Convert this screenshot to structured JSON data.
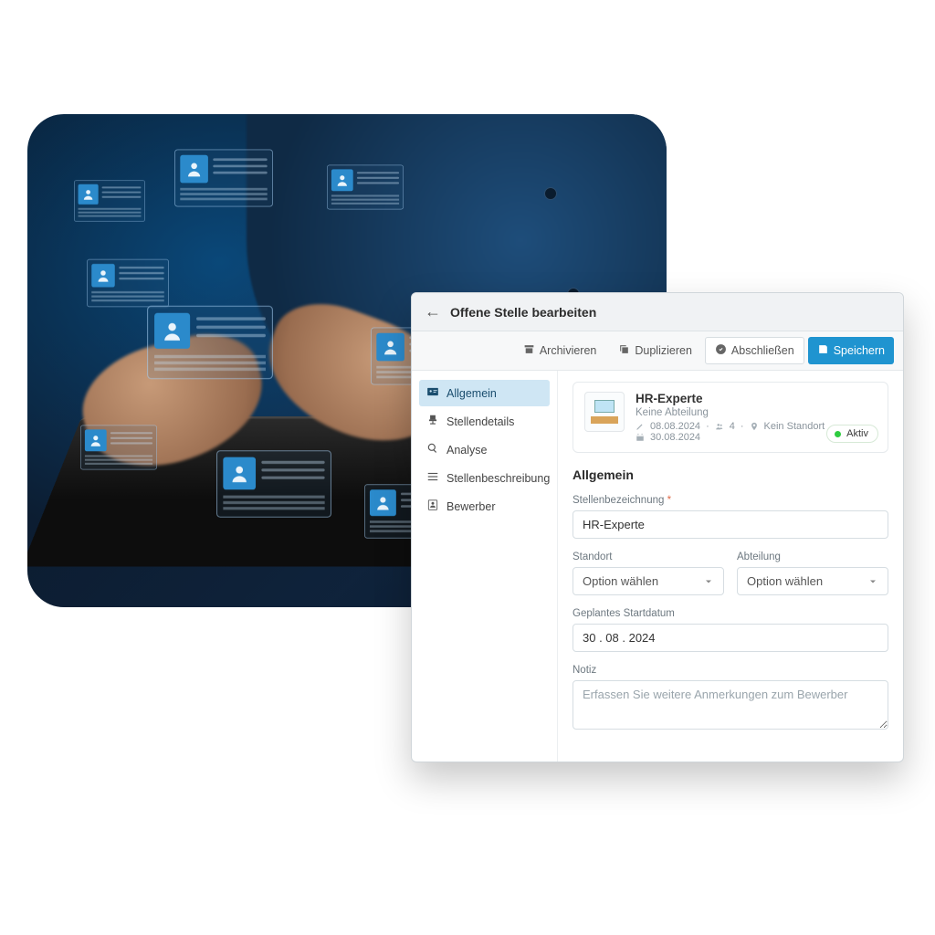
{
  "header": {
    "title": "Offene Stelle bearbeiten"
  },
  "toolbar": {
    "archive": "Archivieren",
    "duplicate": "Duplizieren",
    "close": "Abschließen",
    "save": "Speichern"
  },
  "sidebar": {
    "items": [
      {
        "label": "Allgemein"
      },
      {
        "label": "Stellendetails"
      },
      {
        "label": "Analyse"
      },
      {
        "label": "Stellenbeschreibung"
      },
      {
        "label": "Bewerber"
      }
    ]
  },
  "summary": {
    "title": "HR-Experte",
    "department": "Keine Abteilung",
    "created": "08.08.2024",
    "applicants": "4",
    "location": "Kein Standort",
    "startdate": "30.08.2024",
    "status": "Aktiv"
  },
  "form": {
    "section_title": "Allgemein",
    "job_title": {
      "label": "Stellenbezeichnung",
      "value": "HR-Experte"
    },
    "location": {
      "label": "Standort",
      "placeholder": "Option wählen"
    },
    "department": {
      "label": "Abteilung",
      "placeholder": "Option wählen"
    },
    "planned_start": {
      "label": "Geplantes Startdatum",
      "value": "30 . 08 . 2024"
    },
    "note": {
      "label": "Notiz",
      "placeholder": "Erfassen Sie weitere Anmerkungen zum Bewerber"
    }
  }
}
